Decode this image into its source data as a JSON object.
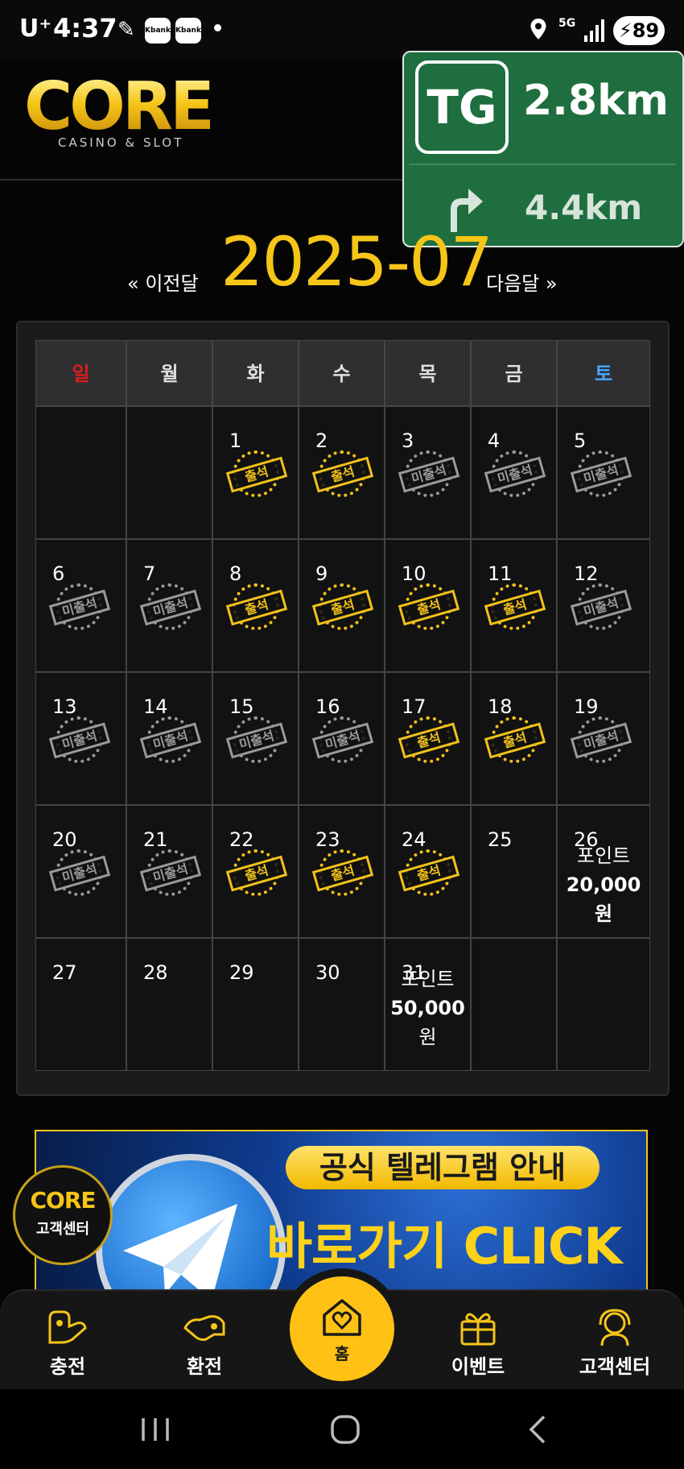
{
  "status_bar": {
    "carrier": "U⁺",
    "time": "4:37",
    "notif_icons": [
      "Kbank",
      "Kbank"
    ],
    "network": "5G",
    "battery": "89"
  },
  "header": {
    "logo_word": "CORE",
    "logo_sub": "CASINO & SLOT"
  },
  "nav_overlay": {
    "road_badge": "TG",
    "distance_1": "2.8km",
    "distance_2": "4.4km"
  },
  "month_nav": {
    "prev": "« 이전달",
    "title": "2025-07",
    "next": "다음달 »"
  },
  "calendar": {
    "weekday_headers": [
      "일",
      "월",
      "화",
      "수",
      "목",
      "금",
      "토"
    ],
    "weekday_colors": [
      "#e01b1b",
      "#e0e0e0",
      "#e0e0e0",
      "#e0e0e0",
      "#e0e0e0",
      "#e0e0e0",
      "#4aa8ff"
    ],
    "weeks": [
      [
        {
          "day": ""
        },
        {
          "day": ""
        },
        {
          "day": "1",
          "stamp": "출석"
        },
        {
          "day": "2",
          "stamp": "출석"
        },
        {
          "day": "3",
          "stamp": "미출석"
        },
        {
          "day": "4",
          "stamp": "미출석"
        },
        {
          "day": "5",
          "stamp": "미출석"
        }
      ],
      [
        {
          "day": "6",
          "stamp": "미출석"
        },
        {
          "day": "7",
          "stamp": "미출석"
        },
        {
          "day": "8",
          "stamp": "출석"
        },
        {
          "day": "9",
          "stamp": "출석"
        },
        {
          "day": "10",
          "stamp": "출석"
        },
        {
          "day": "11",
          "stamp": "출석"
        },
        {
          "day": "12",
          "stamp": "미출석"
        }
      ],
      [
        {
          "day": "13",
          "stamp": "미출석"
        },
        {
          "day": "14",
          "stamp": "미출석"
        },
        {
          "day": "15",
          "stamp": "미출석"
        },
        {
          "day": "16",
          "stamp": "미출석"
        },
        {
          "day": "17",
          "stamp": "출석"
        },
        {
          "day": "18",
          "stamp": "출석"
        },
        {
          "day": "19",
          "stamp": "미출석"
        }
      ],
      [
        {
          "day": "20",
          "stamp": "미출석"
        },
        {
          "day": "21",
          "stamp": "미출석"
        },
        {
          "day": "22",
          "stamp": "출석"
        },
        {
          "day": "23",
          "stamp": "출석"
        },
        {
          "day": "24",
          "stamp": "출석"
        },
        {
          "day": "25"
        },
        {
          "day": "26",
          "reward": [
            "포인트",
            "20,000 원"
          ]
        }
      ],
      [
        {
          "day": "27"
        },
        {
          "day": "28"
        },
        {
          "day": "29"
        },
        {
          "day": "30"
        },
        {
          "day": "31",
          "reward": [
            "포인트",
            "50,000",
            "원"
          ]
        },
        {
          "day": ""
        },
        {
          "day": ""
        }
      ]
    ]
  },
  "banner": {
    "line1": "공식 텔레그램 안내",
    "line2": "바로가기 CLICK"
  },
  "cs_badge": {
    "logo": "CORE",
    "label": "고객센터"
  },
  "bottom_nav": {
    "charge": "충전",
    "exchange": "환전",
    "home": "홈",
    "event": "이벤트",
    "support": "고객센터"
  }
}
